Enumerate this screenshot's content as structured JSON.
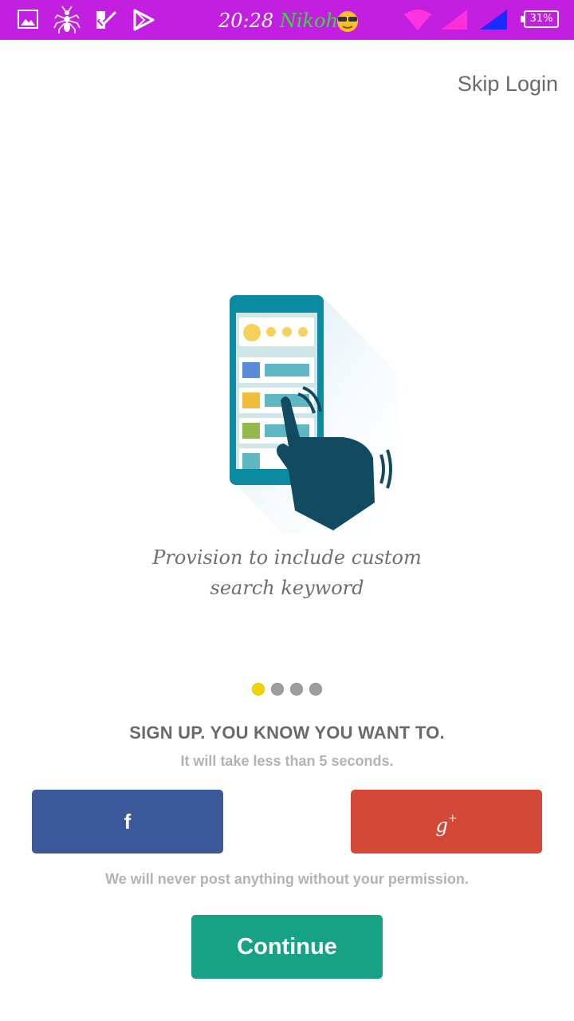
{
  "status_bar": {
    "time": "20:28",
    "carrier": "Nikoh",
    "battery": "31%",
    "background": "#c21fe0"
  },
  "top": {
    "skip_label": "Skip Login"
  },
  "onboarding": {
    "caption_line1": "Provision to include custom",
    "caption_line2": "search keyword",
    "pages_total": 4,
    "active_page": 1
  },
  "signup": {
    "heading": "SIGN UP. YOU KNOW YOU WANT TO.",
    "subheading": "It will take less than 5 seconds.",
    "facebook_label": "f",
    "google_label": "g",
    "google_sup": "+",
    "notice": "We will never post anything without your permission.",
    "continue_label": "Continue"
  },
  "colors": {
    "facebook": "#3b5998",
    "google": "#d34836",
    "continue": "#17a287",
    "active_dot": "#f4d400"
  },
  "icons": [
    "gallery-icon",
    "ant-icon",
    "tasks-icon",
    "play-store-icon",
    "emoji-sunglasses-icon",
    "wifi-icon",
    "signal-icon",
    "signal-icon-2",
    "battery-icon"
  ]
}
